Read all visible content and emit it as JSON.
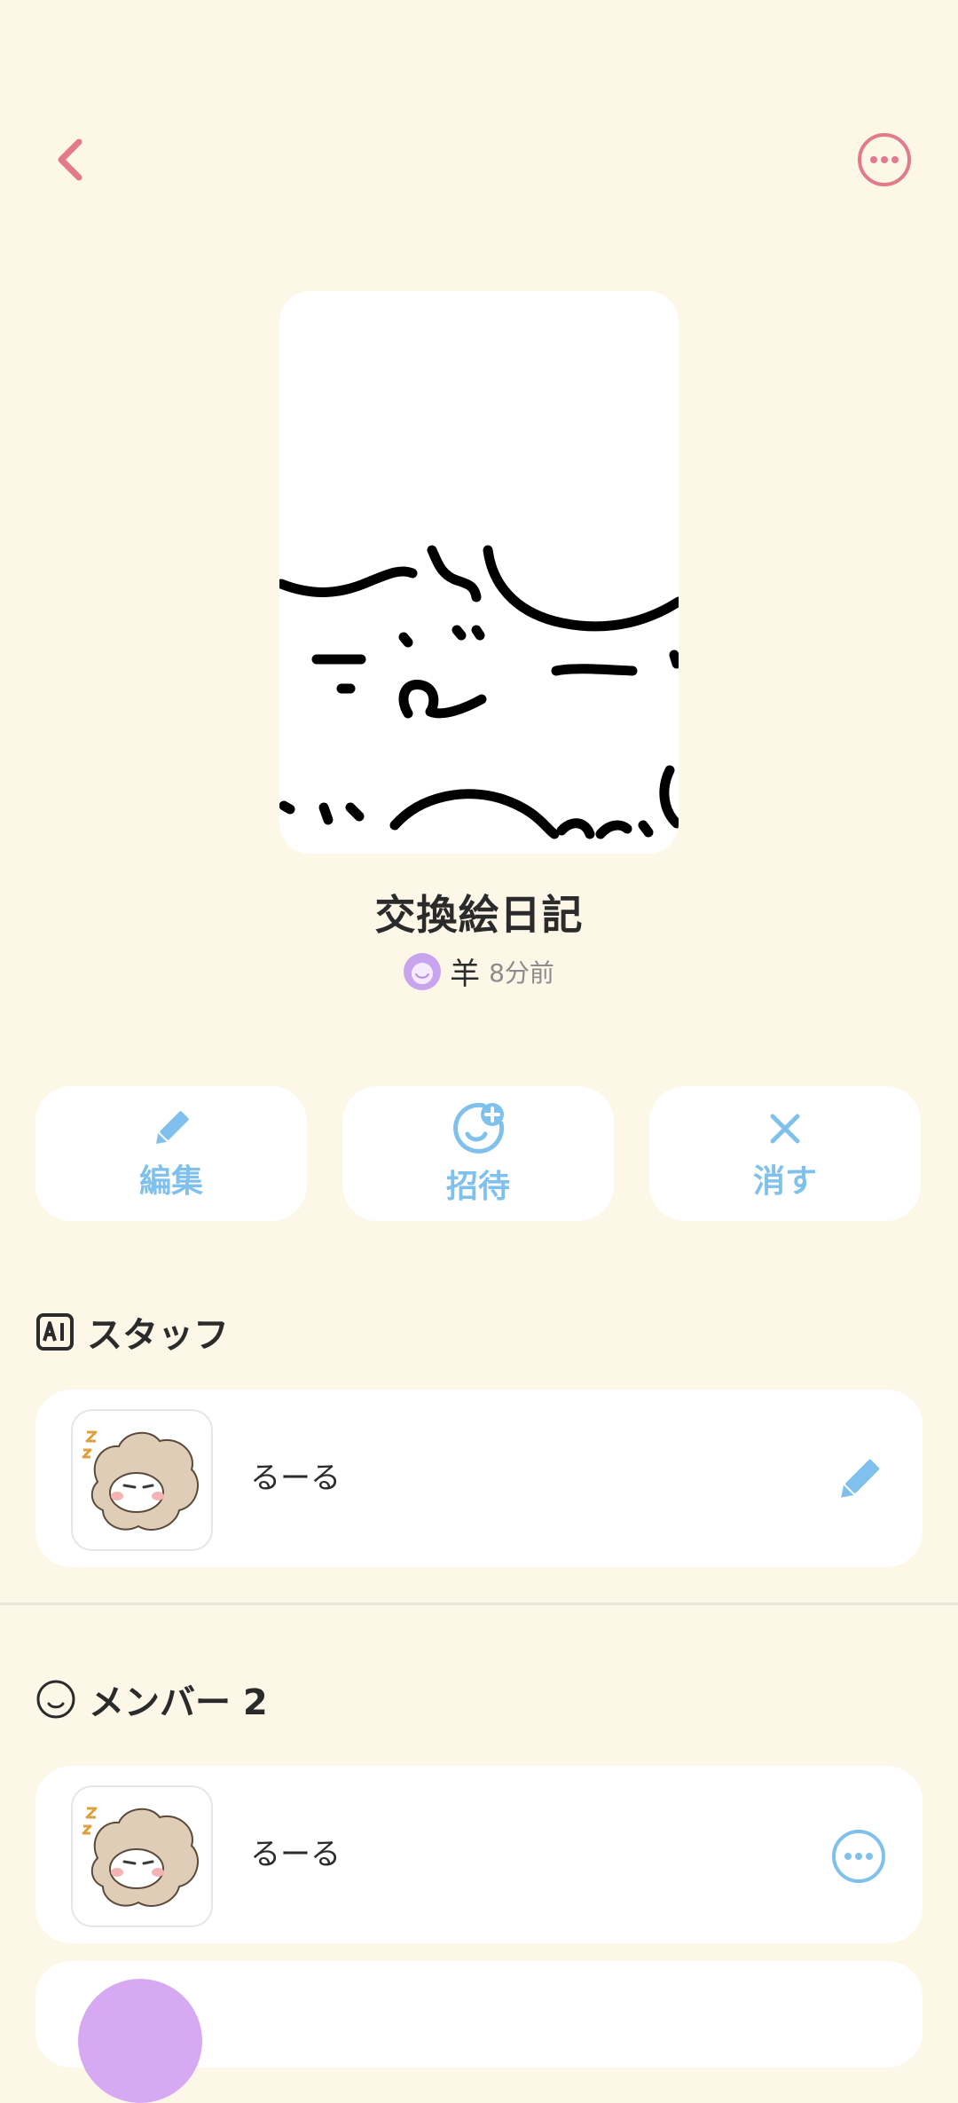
{
  "header": {
    "back_icon": "chevron-left-icon",
    "more_icon": "more-horizontal-circle-icon",
    "accent_color": "#e27a8c"
  },
  "diary": {
    "title": "交換絵日記",
    "owner_name": "羊",
    "posted_time": "8分前"
  },
  "actions": {
    "edit_label": "編集",
    "invite_label": "招待",
    "delete_label": "消す",
    "color": "#7fc1ec"
  },
  "staff": {
    "section_title": "スタッフ",
    "section_icon": "ai-badge-icon",
    "items": [
      {
        "name": "るーる",
        "action_icon": "pencil-icon"
      }
    ]
  },
  "members": {
    "section_title": "メンバー 2",
    "section_icon": "smile-face-icon",
    "items": [
      {
        "name": "るーる",
        "action_icon": "more-horizontal-circle-icon"
      },
      {
        "name": "",
        "action_icon": ""
      }
    ]
  }
}
